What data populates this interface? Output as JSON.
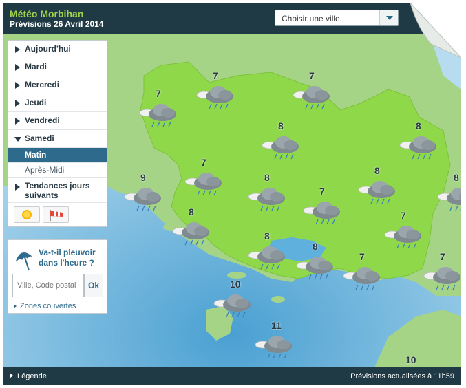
{
  "header": {
    "title": "Météo Morbihan",
    "subtitle": "Prévisions 26 Avril 2014",
    "city_select": "Choisir une ville"
  },
  "sidebar": {
    "days": [
      {
        "label": "Aujourd'hui"
      },
      {
        "label": "Mardi"
      },
      {
        "label": "Mercredi"
      },
      {
        "label": "Jeudi"
      },
      {
        "label": "Vendredi"
      },
      {
        "label": "Samedi"
      }
    ],
    "periods": [
      {
        "label": "Matin",
        "active": true
      },
      {
        "label": "Après-Midi",
        "active": false
      }
    ],
    "trend": "Tendances jours suivants",
    "icons": [
      "sun-icon",
      "windsock-icon"
    ]
  },
  "rain_box": {
    "title": "Va-t-il pleuvoir dans l'heure ?",
    "placeholder": "Ville, Code postal",
    "ok": "Ok",
    "zones": "Zones couvertes"
  },
  "map": {
    "forecasts": [
      {
        "temp": "7",
        "icon": "rain-cloud-icon"
      },
      {
        "temp": "7",
        "icon": "rain-cloud-icon"
      },
      {
        "temp": "7",
        "icon": "rain-cloud-icon"
      },
      {
        "temp": "8",
        "icon": "rain-cloud-icon"
      },
      {
        "temp": "8",
        "icon": "rain-cloud-icon"
      },
      {
        "temp": "7",
        "icon": "rain-cloud-icon"
      },
      {
        "temp": "9",
        "icon": "rain-cloud-icon"
      },
      {
        "temp": "8",
        "icon": "rain-cloud-icon"
      },
      {
        "temp": "8",
        "icon": "rain-cloud-icon"
      },
      {
        "temp": "8",
        "icon": "rain-cloud-icon"
      },
      {
        "temp": "7",
        "icon": "rain-cloud-icon"
      },
      {
        "temp": "8",
        "icon": "rain-cloud-icon"
      },
      {
        "temp": "7",
        "icon": "rain-cloud-icon"
      },
      {
        "temp": "8",
        "icon": "rain-cloud-icon"
      },
      {
        "temp": "8",
        "icon": "rain-cloud-icon"
      },
      {
        "temp": "7",
        "icon": "rain-cloud-icon"
      },
      {
        "temp": "7",
        "icon": "rain-cloud-icon"
      },
      {
        "temp": "10",
        "icon": "rain-cloud-icon"
      },
      {
        "temp": "11",
        "icon": "rain-cloud-icon"
      },
      {
        "temp": "10",
        "icon": "rain-cloud-icon"
      }
    ]
  },
  "footer": {
    "legend": "Légende",
    "updated": "Prévisions actualisées à 11h59"
  },
  "colors": {
    "frame": "#1f3a45",
    "land": "#8ed84a",
    "land_outside": "#a8d08a",
    "sea": "#8fc6e2",
    "accent_title": "#9fd34a",
    "active_period": "#2d6a8c"
  }
}
